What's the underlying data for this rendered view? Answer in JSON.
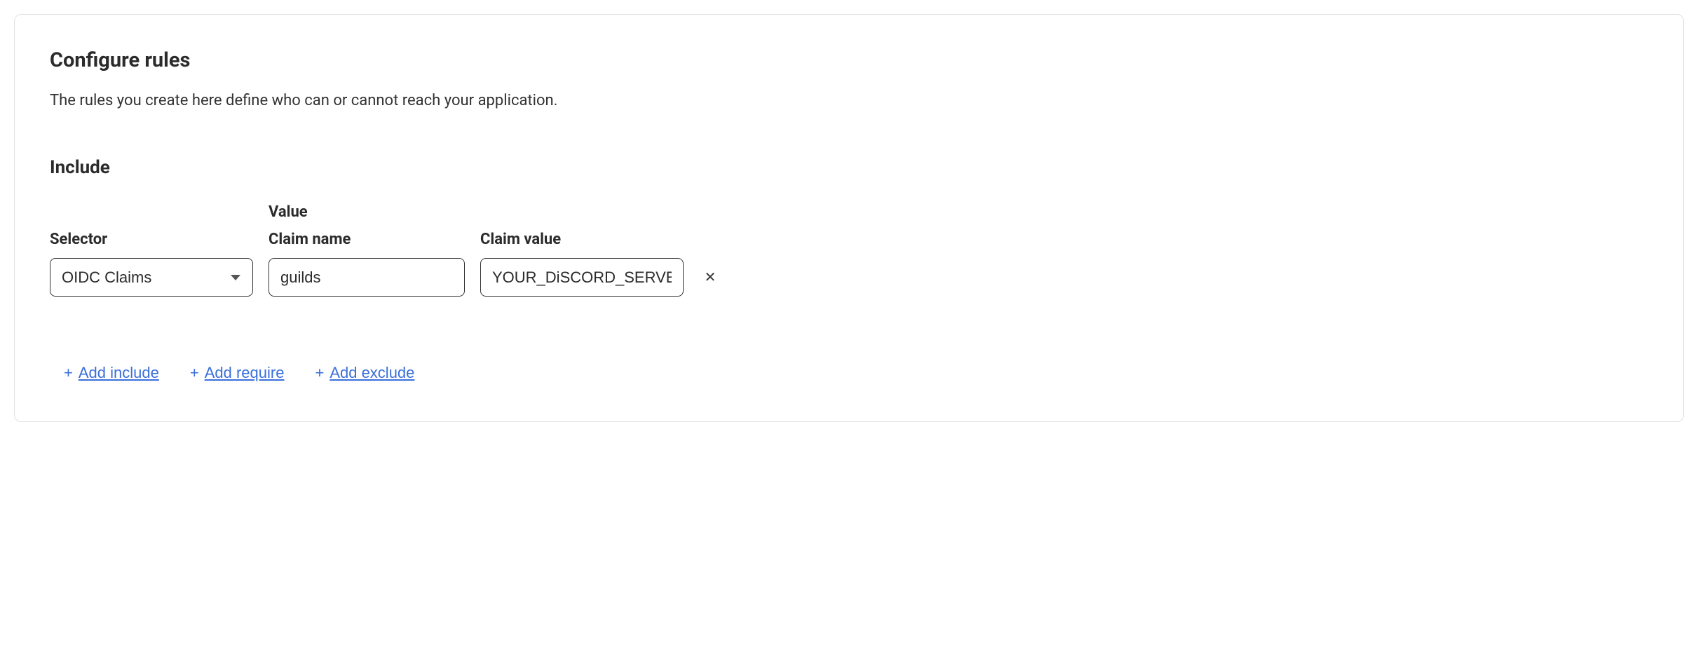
{
  "header": {
    "title": "Configure rules",
    "description": "The rules you create here define who can or cannot reach your application."
  },
  "section": {
    "include_label": "Include",
    "selector_label": "Selector",
    "value_label": "Value",
    "claim_name_label": "Claim name",
    "claim_value_label": "Claim value"
  },
  "rule": {
    "selector_value": "OIDC Claims",
    "claim_name": "guilds",
    "claim_value": "YOUR_DiSCORD_SERVER_"
  },
  "actions": {
    "add_include": "Add include",
    "add_require": "Add require",
    "add_exclude": "Add exclude",
    "plus": "+"
  }
}
